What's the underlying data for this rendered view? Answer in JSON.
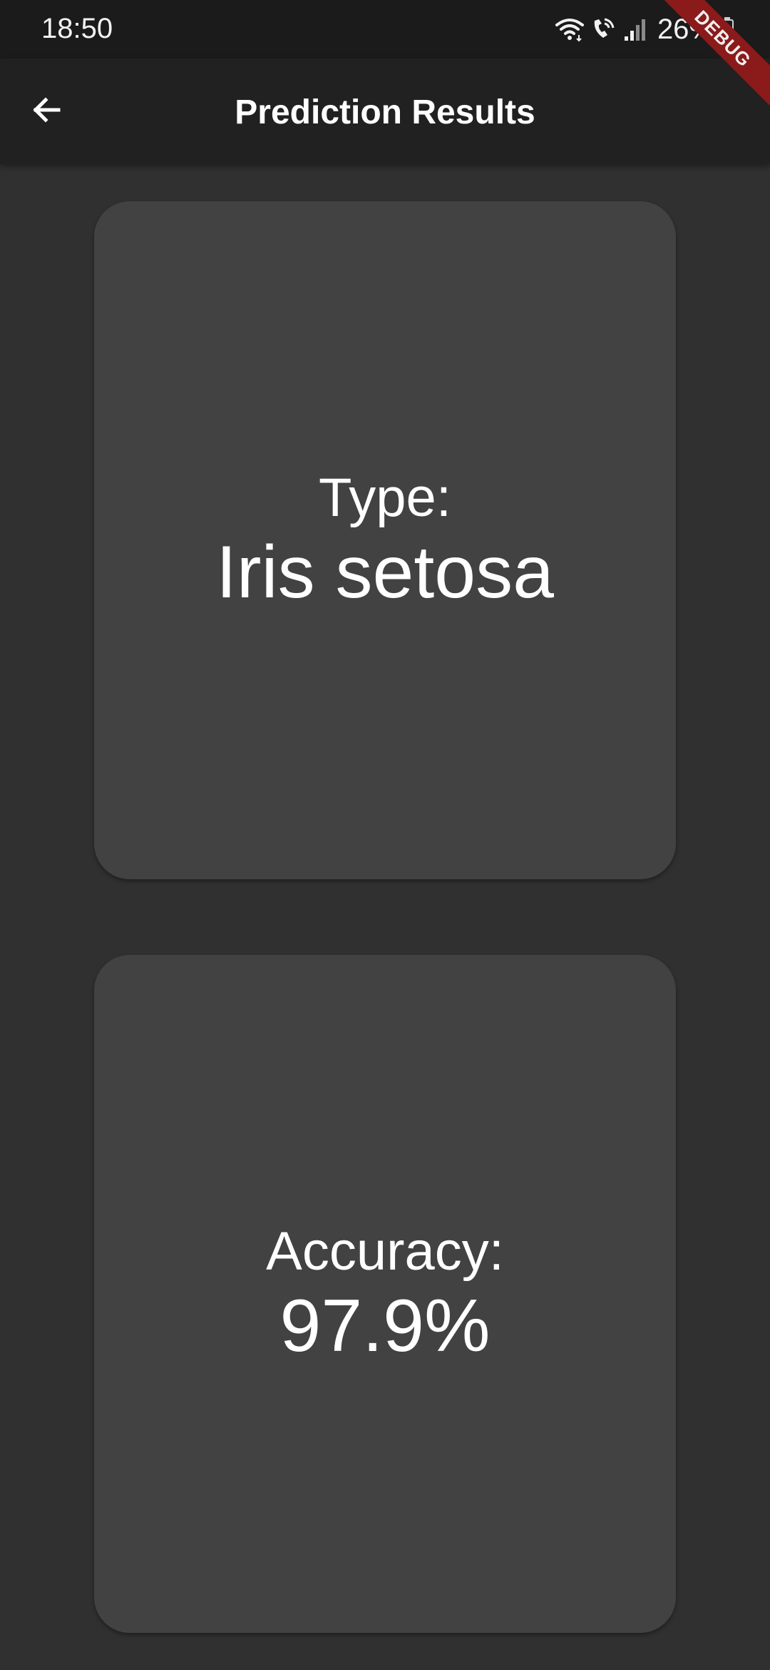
{
  "status_bar": {
    "time": "18:50",
    "battery": "26%",
    "icons": [
      "wifi-icon",
      "call-icon",
      "signal-icon",
      "battery-icon"
    ]
  },
  "debug_banner": "DEBUG",
  "app_bar": {
    "back_icon": "arrow-left-icon",
    "title": "Prediction Results"
  },
  "cards": {
    "type": {
      "label": "Type:",
      "value": "Iris setosa"
    },
    "accuracy": {
      "label": "Accuracy:",
      "value": "97.9%"
    }
  },
  "colors": {
    "background": "#303030",
    "app_bar": "#212121",
    "status_bar": "#1b1b1b",
    "card": "#424242",
    "text": "#ffffff",
    "debug_ribbon": "#8b1a1a"
  }
}
